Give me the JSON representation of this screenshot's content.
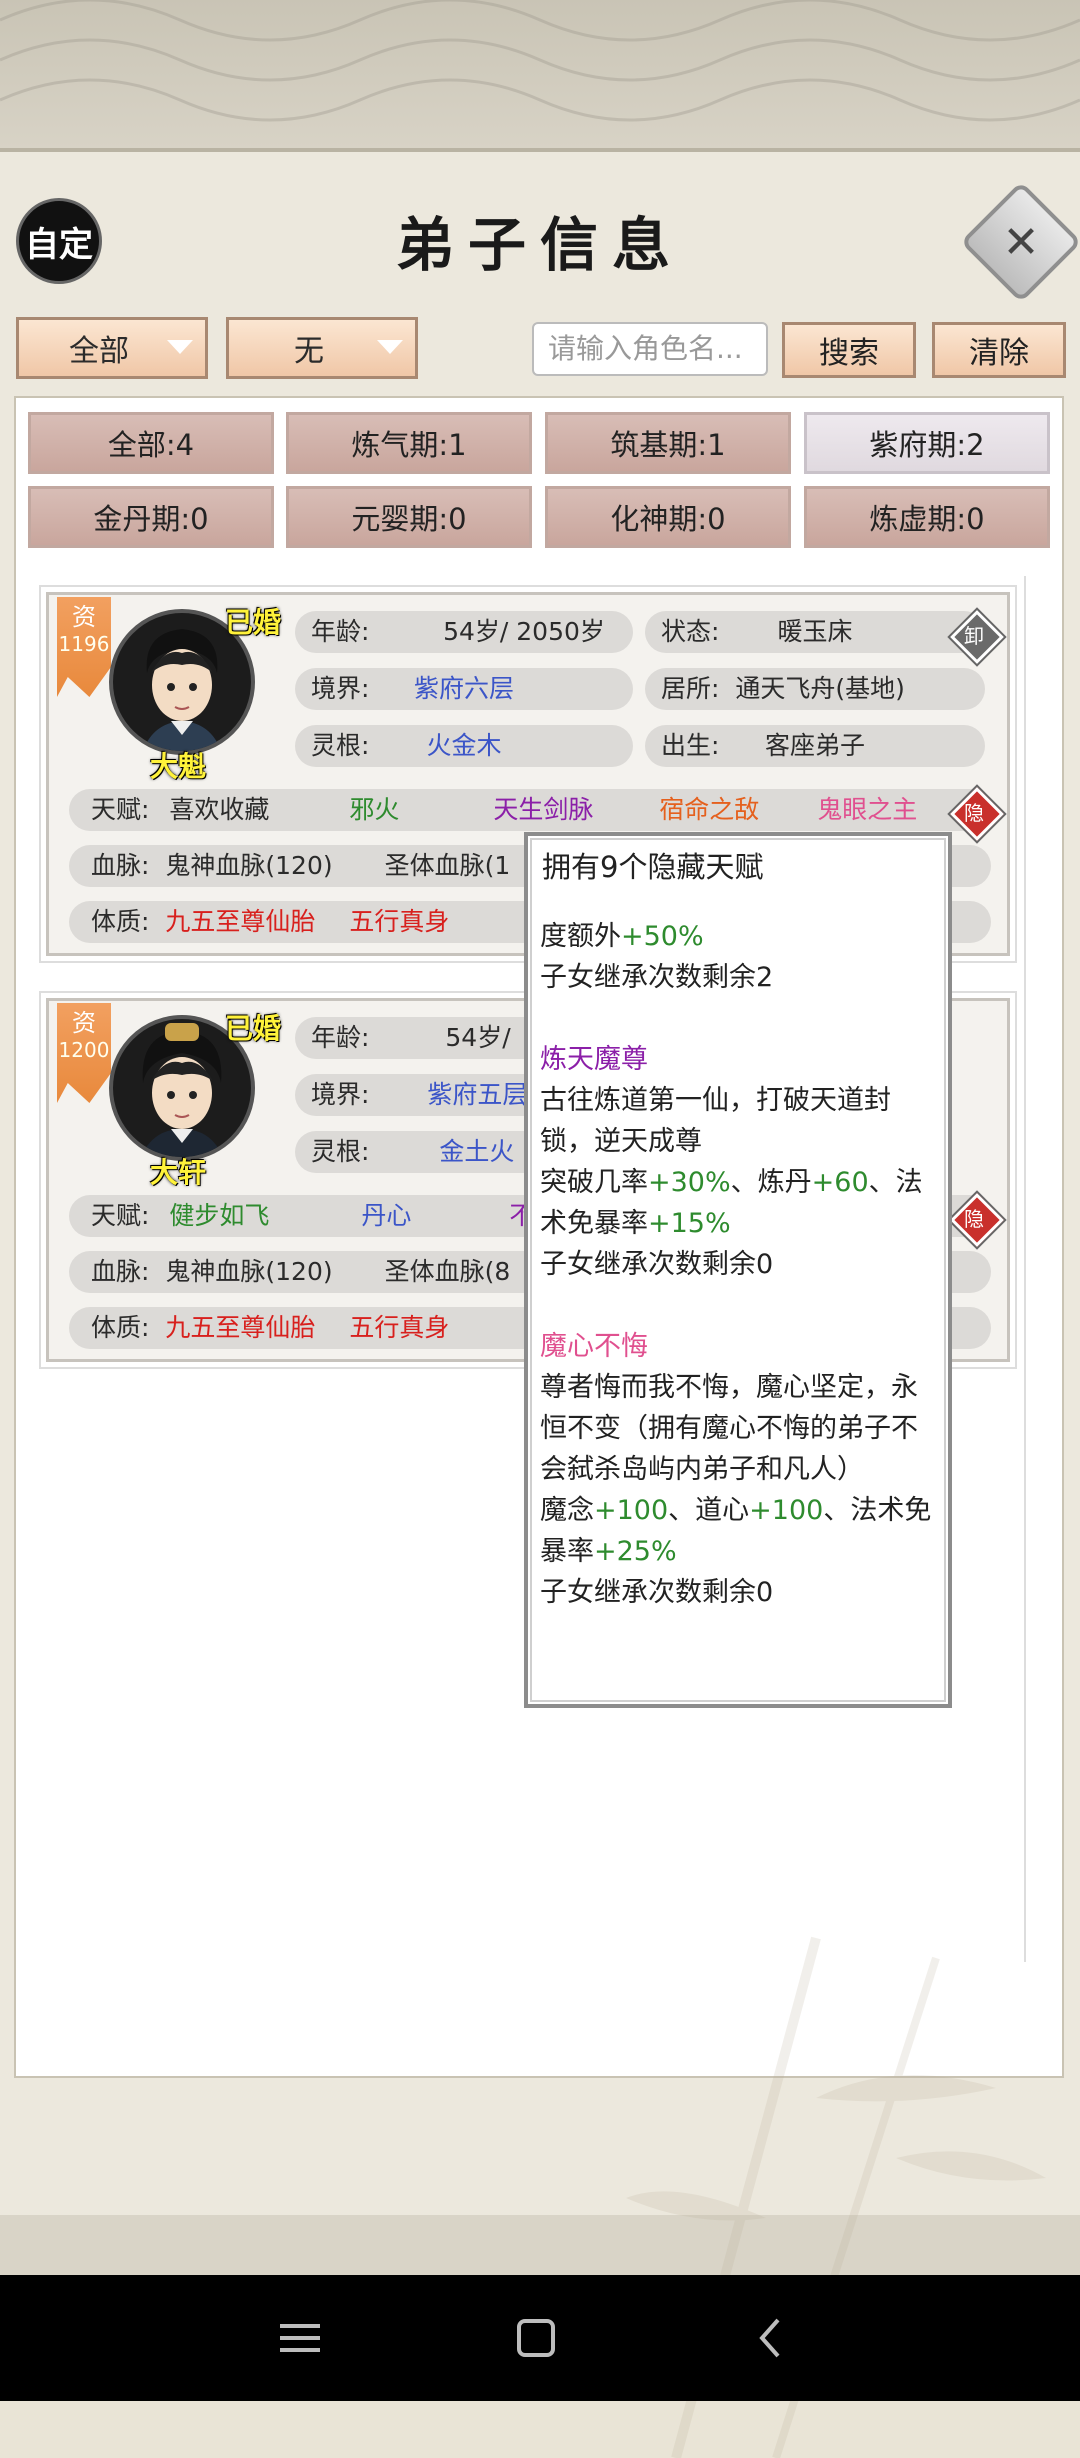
{
  "header": {
    "title": "弟子信息",
    "custom_button": "自定"
  },
  "filters": {
    "filter1": "全部",
    "filter2": "无",
    "search_placeholder": "请输入角色名...",
    "search_button": "搜索",
    "clear_button": "清除"
  },
  "tabs": [
    {
      "label": "全部:4"
    },
    {
      "label": "炼气期:1"
    },
    {
      "label": "筑基期:1"
    },
    {
      "label": "紫府期:2"
    },
    {
      "label": "金丹期:0"
    },
    {
      "label": "元婴期:0"
    },
    {
      "label": "化神期:0"
    },
    {
      "label": "炼虚期:0"
    }
  ],
  "disciples": [
    {
      "zi_label": "资",
      "zi_value": "1196",
      "married": "已婚",
      "name": "大魁",
      "age_label": "年龄:",
      "age": "54岁/ 2050岁",
      "status_label": "状态:",
      "status": "暖玉床",
      "realm_label": "境界:",
      "realm": "紫府六层",
      "residence_label": "居所:",
      "residence": "通天飞舟(基地)",
      "root_label": "灵根:",
      "root": "火金木",
      "birth_label": "出生:",
      "birth": "客座弟子",
      "talent_label": "天赋:",
      "talents": [
        "喜欢收藏",
        "邪火",
        "天生剑脉",
        "宿命之敌",
        "鬼眼之主"
      ],
      "bloodline_label": "血脉:",
      "bloodlines": [
        "鬼神血脉(120)",
        "圣体血脉(1"
      ],
      "physique_label": "体质:",
      "physiques": [
        "九五至尊仙胎",
        "五行真身"
      ],
      "badge_top": "卸",
      "badge_hidden": "隐"
    },
    {
      "zi_label": "资",
      "zi_value": "1200",
      "married": "已婚",
      "name": "大轩",
      "age_label": "年龄:",
      "age": "54岁/",
      "realm_label": "境界:",
      "realm": "紫府五层",
      "root_label": "灵根:",
      "root": "金土火",
      "talent_label": "天赋:",
      "talents": [
        "健步如飞",
        "丹心",
        "不"
      ],
      "bloodline_label": "血脉:",
      "bloodlines": [
        "鬼神血脉(120)",
        "圣体血脉(8"
      ],
      "physique_label": "体质:",
      "physiques": [
        "九五至尊仙胎",
        "五行真身"
      ],
      "badge_hidden": "隐"
    }
  ],
  "tooltip": {
    "header": "拥有9个隐藏天赋",
    "line_a1": "度额外",
    "line_a1_val": "+50%",
    "line_a2": "子女继承次数剩余2",
    "t1_name": "炼天魔尊",
    "t1_desc": "古往炼道第一仙，打破天道封锁，逆天成尊",
    "t1_e1": "突破几率",
    "t1_v1": "+30%",
    "t1_e2": "、炼丹",
    "t1_v2": "+60",
    "t1_e3": "、法术免暴率",
    "t1_v3": "+15%",
    "t1_inherit": "子女继承次数剩余0",
    "t2_name": "魔心不悔",
    "t2_desc": "尊者悔而我不悔，魔心坚定，永恒不变（拥有魔心不悔的弟子不会弑杀岛屿内弟子和凡人）",
    "t2_e1": "魔念",
    "t2_v1": "+100",
    "t2_e2": "、道心",
    "t2_v2": "+100",
    "t2_e3": "、法术免暴率",
    "t2_v3": "+25%",
    "t2_inherit": "子女继承次数剩余0"
  }
}
